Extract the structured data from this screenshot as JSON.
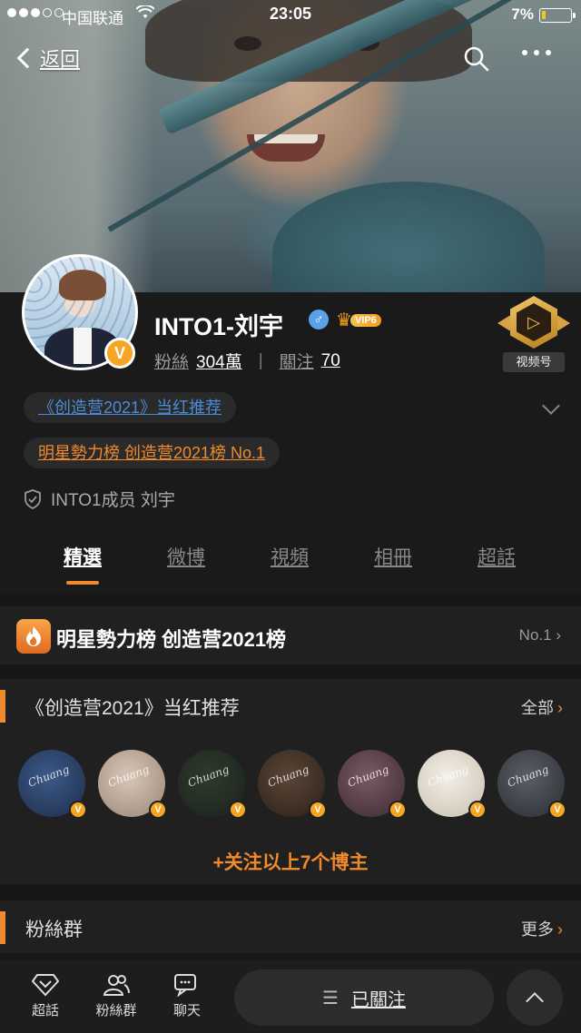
{
  "status_bar": {
    "carrier": "中国联通",
    "time": "23:05",
    "battery": "7%"
  },
  "nav": {
    "back_label": "返回"
  },
  "profile": {
    "name": "INTO1-刘宇",
    "vip_level": "VIP6",
    "fans_label": "粉絲",
    "fans_count": "304萬",
    "following_label": "關注",
    "following_count": "70",
    "video_badge_label": "视频号",
    "tag_recommend": "《创造营2021》当红推荐",
    "tag_rank": "明星勢力榜 创造营2021榜 No.1",
    "certification": "INTO1成员 刘宇"
  },
  "tabs": [
    "精選",
    "微博",
    "視頻",
    "相冊",
    "超話"
  ],
  "rank_card": {
    "title": "明星勢力榜 创造营2021榜",
    "rank": "No.1"
  },
  "recommend": {
    "title": "《创造营2021》当红推荐",
    "more_label": "全部",
    "follow_all": "+关注以上7个博主",
    "avatars": [
      {
        "colors": [
          "#3c5a8a",
          "#1e2c48"
        ],
        "text": "Chuang"
      },
      {
        "colors": [
          "#d8c7b8",
          "#9c8574"
        ],
        "text": "Chuang"
      },
      {
        "colors": [
          "#2f3b2f",
          "#1a221a"
        ],
        "text": "Chuang"
      },
      {
        "colors": [
          "#5b4636",
          "#2b2019"
        ],
        "text": "Chuang"
      },
      {
        "colors": [
          "#7a5a64",
          "#3b2a33"
        ],
        "text": "Chuang"
      },
      {
        "colors": [
          "#f3efe8",
          "#c9bfae"
        ],
        "text": "Chuang"
      },
      {
        "colors": [
          "#5a5e66",
          "#2a2d33"
        ],
        "text": "Chuang"
      }
    ]
  },
  "fans_group": {
    "title": "粉絲群",
    "more_label": "更多"
  },
  "bottom_bar": {
    "chaohua": "超話",
    "fans_group": "粉絲群",
    "chat": "聊天",
    "followed": "已關注"
  },
  "colors": {
    "accent": "#f08a2c",
    "link_blue": "#4c8bd6",
    "background": "#171717"
  }
}
